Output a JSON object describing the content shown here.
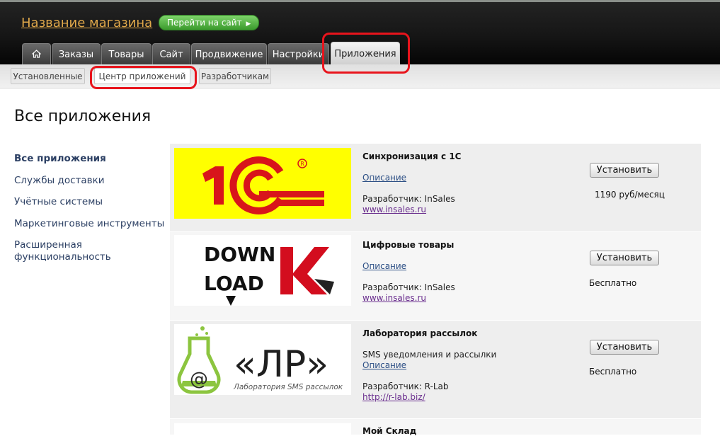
{
  "header": {
    "shop_name": "Название магазина",
    "visit_button": "Перейти на сайт",
    "tabs": [
      {
        "label": "Заказы"
      },
      {
        "label": "Товары"
      },
      {
        "label": "Сайт"
      },
      {
        "label": "Продвижение"
      },
      {
        "label": "Настройки"
      },
      {
        "label": "Приложения"
      }
    ],
    "active_tab": "Приложения"
  },
  "subnav": {
    "tabs": [
      {
        "label": "Установленные"
      },
      {
        "label": "Центр приложений"
      },
      {
        "label": "Разработчикам"
      }
    ],
    "active_tab": "Центр приложений"
  },
  "page": {
    "title": "Все приложения"
  },
  "categories": [
    {
      "label": "Все приложения"
    },
    {
      "label": "Службы доставки"
    },
    {
      "label": "Учётные системы"
    },
    {
      "label": "Маркетинговые инструменты"
    },
    {
      "label": "Расширенная функциональность"
    }
  ],
  "apps": [
    {
      "title": "Синхронизация с 1С",
      "description_link": "Описание",
      "developer": "Разработчик: InSales",
      "url": "www.insales.ru",
      "install": "Установить",
      "price": "1190 руб/месяц",
      "logo_text": "1С"
    },
    {
      "title": "Цифровые товары",
      "description_link": "Описание",
      "developer": "Разработчик: InSales",
      "url": "www.insales.ru",
      "install": "Установить",
      "price": "Бесплатно",
      "logo_line1": "DOWN",
      "logo_line2": "LOAD"
    },
    {
      "title": "Лаборатория рассылок",
      "subtitle": "SMS уведомления и рассылки",
      "description_link": "Описание",
      "developer": "Разработчик: R-Lab",
      "url": "http://r-lab.biz/",
      "install": "Установить",
      "price": "Бесплатно",
      "logo_text": "«ЛР»",
      "logo_caption": "Лаборатория SMS рассылок",
      "logo_at": "@"
    },
    {
      "title": "Мой Склад"
    }
  ],
  "colors": {
    "annotation": "#e8141c",
    "link": "#2c4f85",
    "visited_link": "#6a2e8e",
    "shop_name": "#e0a84a"
  }
}
